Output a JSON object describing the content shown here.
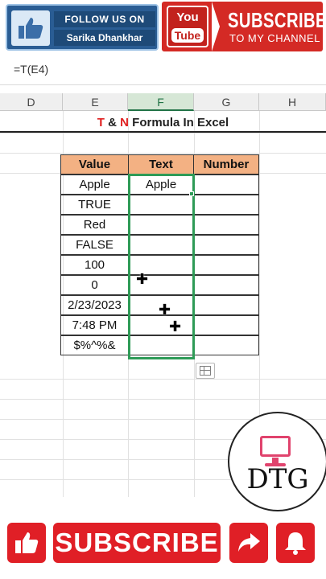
{
  "banner": {
    "follow_line1": "FOLLOW US ON",
    "follow_line2": "Sarika Dhankhar",
    "yt_you": "You",
    "yt_tube": "Tube",
    "subscribe": "SUBSCRIBE",
    "to_channel": "TO MY CHANNEL",
    "icons": [
      "thumbs-up-icon",
      "youtube-logo-icon"
    ]
  },
  "formula_bar": {
    "text": "=T(E4)"
  },
  "columns": [
    {
      "id": "col-d",
      "label": "D",
      "active": false
    },
    {
      "id": "col-e",
      "label": "E",
      "active": false
    },
    {
      "id": "col-f",
      "label": "F",
      "active": true
    },
    {
      "id": "col-g",
      "label": "G",
      "active": false
    },
    {
      "id": "col-h",
      "label": "H",
      "active": false
    }
  ],
  "title": {
    "t": "T",
    "amp": " & ",
    "n": "N",
    "rest": " Formula In Excel"
  },
  "table": {
    "headers": [
      "Value",
      "Text",
      "Number"
    ],
    "rows": [
      [
        "Apple",
        "Apple",
        ""
      ],
      [
        "TRUE",
        "",
        ""
      ],
      [
        "Red",
        "",
        ""
      ],
      [
        "FALSE",
        "",
        ""
      ],
      [
        "100",
        "",
        ""
      ],
      [
        "0",
        "",
        ""
      ],
      [
        "2/23/2023",
        "",
        ""
      ],
      [
        "7:48 PM",
        "",
        ""
      ],
      [
        "$%^%&",
        "",
        ""
      ]
    ]
  },
  "logo": {
    "text": "DTG"
  },
  "bottom": {
    "subscribe": "SUBSCRIBE",
    "icons": [
      "like-icon",
      "share-icon",
      "bell-icon"
    ]
  },
  "colors": {
    "header_fill": "#f3b183",
    "selection": "#2e9b57",
    "subscribe_red": "#e01f26",
    "title_red": "#e02020"
  }
}
